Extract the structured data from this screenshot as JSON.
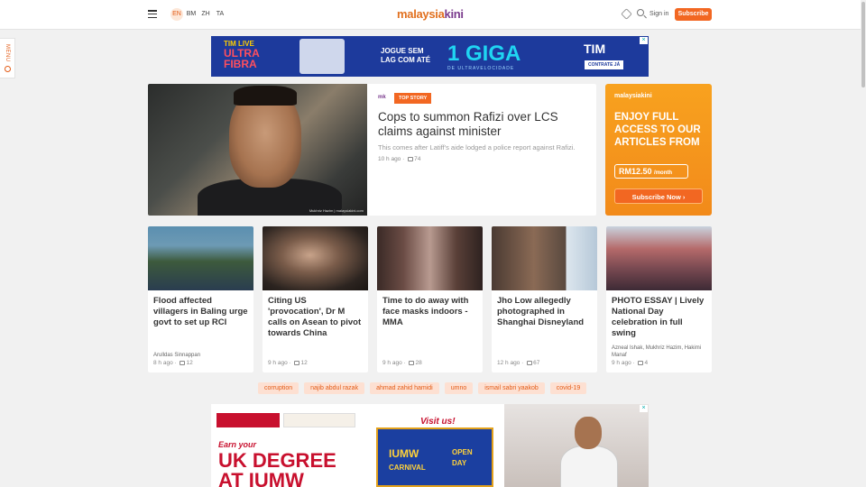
{
  "header": {
    "logo_a": "malaysia",
    "logo_b": "kini",
    "languages": [
      "EN",
      "BM",
      "ZH",
      "TA"
    ],
    "active_language": "EN",
    "signin_label": "Sign in",
    "subscribe_label": "Subscribe"
  },
  "menu_tab": {
    "label": "MENU"
  },
  "ad_top": {
    "line1": "TIM LIVE",
    "line2": "ULTRA",
    "line3": "FIBRA",
    "pitch": "JOGUE SEM LAG COM ATÉ",
    "giga": "1 GIGA",
    "speed": "DE ULTRAVELOCIDADE",
    "brand": "TIM",
    "cta": "CONTRATE JÁ"
  },
  "hero": {
    "badge": "mk",
    "label": "TOP STORY",
    "title": "Cops to summon Rafizi over LCS claims against minister",
    "summary": "This comes after Latiff's aide lodged a police report against Rafizi.",
    "time": "10 h ago",
    "comments": "74",
    "credit": "Mukhriz Hazim | malaysiakini.com"
  },
  "promo": {
    "brand": "malaysiakini",
    "headline": "ENJOY FULL ACCESS TO OUR ARTICLES FROM",
    "price": "RM12.50",
    "period": "/month",
    "cta": "Subscribe Now  ›"
  },
  "cards": [
    {
      "title": "Flood affected villagers in Baling urge govt to set up RCI",
      "author": "Arulldas Sinnappan",
      "time": "8 h ago",
      "comments": "12"
    },
    {
      "title": "Citing US 'provocation', Dr M calls on Asean to pivot towards China",
      "author": "",
      "time": "9 h ago",
      "comments": "12"
    },
    {
      "title": "Time to do away with face masks indoors - MMA",
      "author": "",
      "time": "9 h ago",
      "comments": "28"
    },
    {
      "title": "Jho Low allegedly photographed in Shanghai Disneyland",
      "author": "",
      "time": "12 h ago",
      "comments": "67"
    },
    {
      "title": "PHOTO ESSAY | Lively National Day celebration in full swing",
      "author": "Azneal Ishak, Mukhriz Hazim, Hakimi Manaf",
      "time": "9 h ago",
      "comments": "4"
    }
  ],
  "tags": [
    "corruption",
    "najib abdul razak",
    "ahmad zahid hamidi",
    "umno",
    "ismail sabri yaakob",
    "covid-19"
  ],
  "ad_bottom": {
    "earn": "Earn your",
    "degree": "UK DEGREE",
    "at": "AT IUMW",
    "visit": "Visit us!",
    "carnival_a": "IUMW",
    "carnival_b": "CARNIVAL",
    "open_day": "OPEN DAY"
  },
  "colors": {
    "accent": "#f26722",
    "brand_purple": "#7a3b8d",
    "promo": "#f8a21f"
  }
}
